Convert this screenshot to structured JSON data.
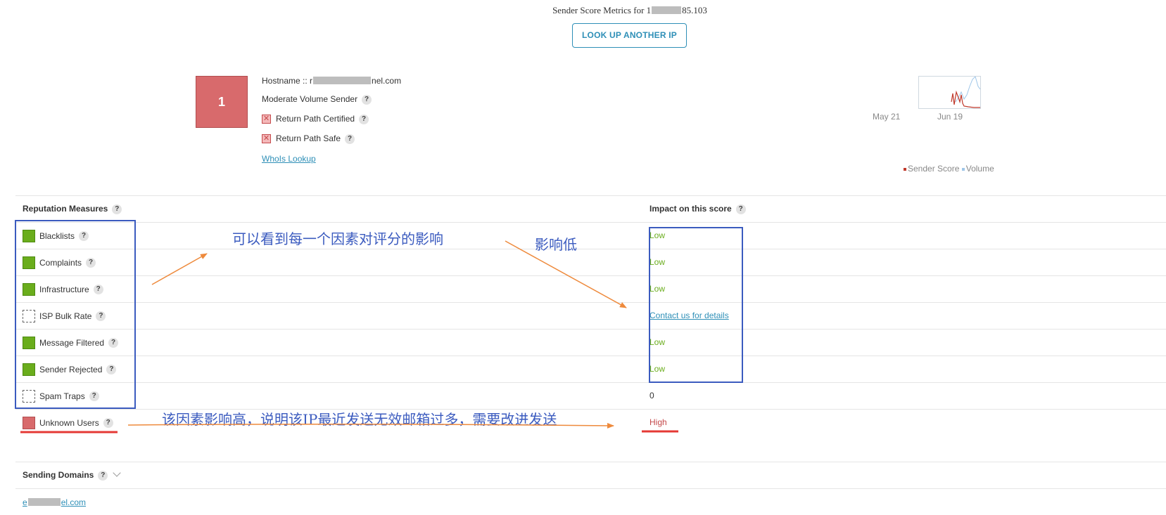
{
  "header": {
    "title_prefix": "Sender Score Metrics for",
    "ip_start": "1",
    "ip_end": "85.103",
    "lookup_button": "LOOK UP ANOTHER IP"
  },
  "score": {
    "value": "1",
    "color": "#d86a6c"
  },
  "info": {
    "hostname_label": "Hostname ::",
    "hostname_start": "r",
    "hostname_end": "nel.com",
    "volume": "Moderate  Volume Sender",
    "certified": "Return Path Certified",
    "safe": "Return Path Safe",
    "whois": "WhoIs Lookup"
  },
  "chart": {
    "date_start": "May 21",
    "date_end": "Jun 19",
    "legend_score": "Sender Score",
    "legend_volume": "Volume",
    "score_color": "#c0392b",
    "volume_color": "#9fc6e8"
  },
  "reputation": {
    "header_left": "Reputation Measures",
    "header_right": "Impact on this score",
    "rows": [
      {
        "label": "Blacklists",
        "status": "green",
        "impact": "Low"
      },
      {
        "label": "Complaints",
        "status": "green",
        "impact": "Low"
      },
      {
        "label": "Infrastructure",
        "status": "green",
        "impact": "Low"
      },
      {
        "label": "ISP Bulk Rate",
        "status": "empty",
        "impact": "Contact us for details"
      },
      {
        "label": "Message Filtered",
        "status": "green",
        "impact": "Low"
      },
      {
        "label": "Sender Rejected",
        "status": "green",
        "impact": "Low"
      },
      {
        "label": "Spam Traps",
        "status": "empty",
        "impact": "0"
      },
      {
        "label": "Unknown Users",
        "status": "red",
        "impact": "High"
      }
    ]
  },
  "sending_domains": {
    "header": "Sending Domains",
    "domain_start": "e",
    "domain_end": "el.com"
  },
  "annotations": {
    "note_each_factor": "可以看到每一个因素对评分的影响",
    "note_low": "影响低",
    "note_high": "该因素影响高，说明该IP最近发送无效邮箱过多，需要改进发送"
  },
  "help_glyph": "?"
}
